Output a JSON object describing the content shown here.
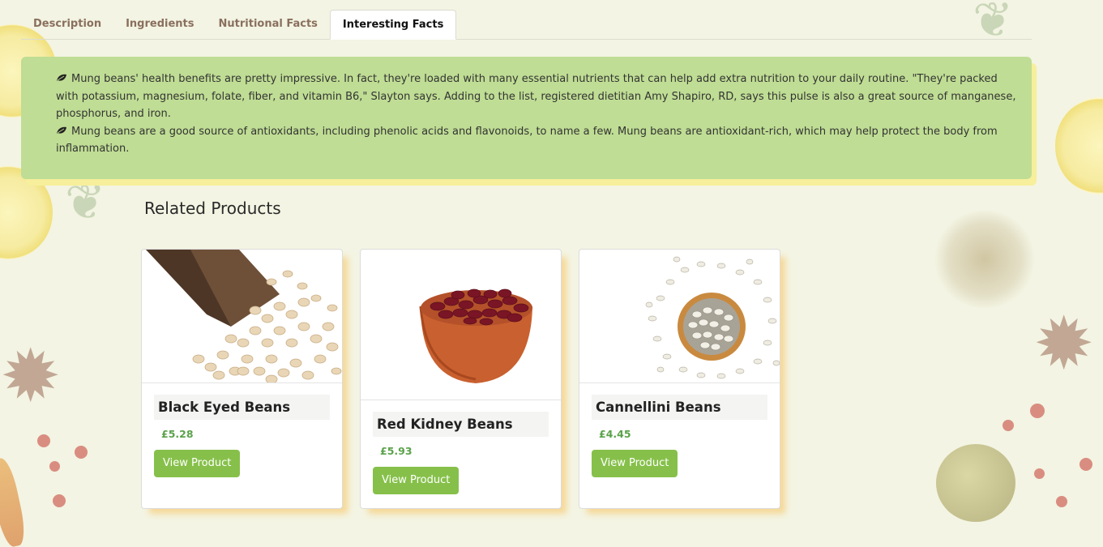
{
  "tabs": [
    {
      "label": "Description"
    },
    {
      "label": "Ingredients"
    },
    {
      "label": "Nutritional Facts"
    },
    {
      "label": "Interesting Facts"
    }
  ],
  "facts": [
    "Mung beans' health benefits are pretty impressive. In fact, they're loaded with many essential nutrients that can help add extra nutrition to your daily routine. \"They're packed with potassium, magnesium, folate, fiber, and vitamin B6,\" Slayton says. Adding to the list, registered dietitian Amy Shapiro, RD, says this pulse is also a great source of manganese, phosphorus, and iron.",
    "Mung beans are a good source of antioxidants, including phenolic acids and flavonoids, to name a few. Mung beans are antioxidant-rich, which may help protect the body from inflammation."
  ],
  "related": {
    "title": "Related Products",
    "products": [
      {
        "name": "Black Eyed Beans",
        "price": "£5.28",
        "button": "View Product"
      },
      {
        "name": "Red Kidney Beans",
        "price": "£5.93",
        "button": "View Product"
      },
      {
        "name": "Cannellini Beans",
        "price": "£4.45",
        "button": "View Product"
      }
    ]
  },
  "colors": {
    "accent_green": "#86c04a",
    "price_green": "#5aa24a",
    "facts_bg": "#bfdd94",
    "page_bg": "#f3f4e3"
  },
  "icons": {
    "fact_bullet": "leaf-icon"
  }
}
